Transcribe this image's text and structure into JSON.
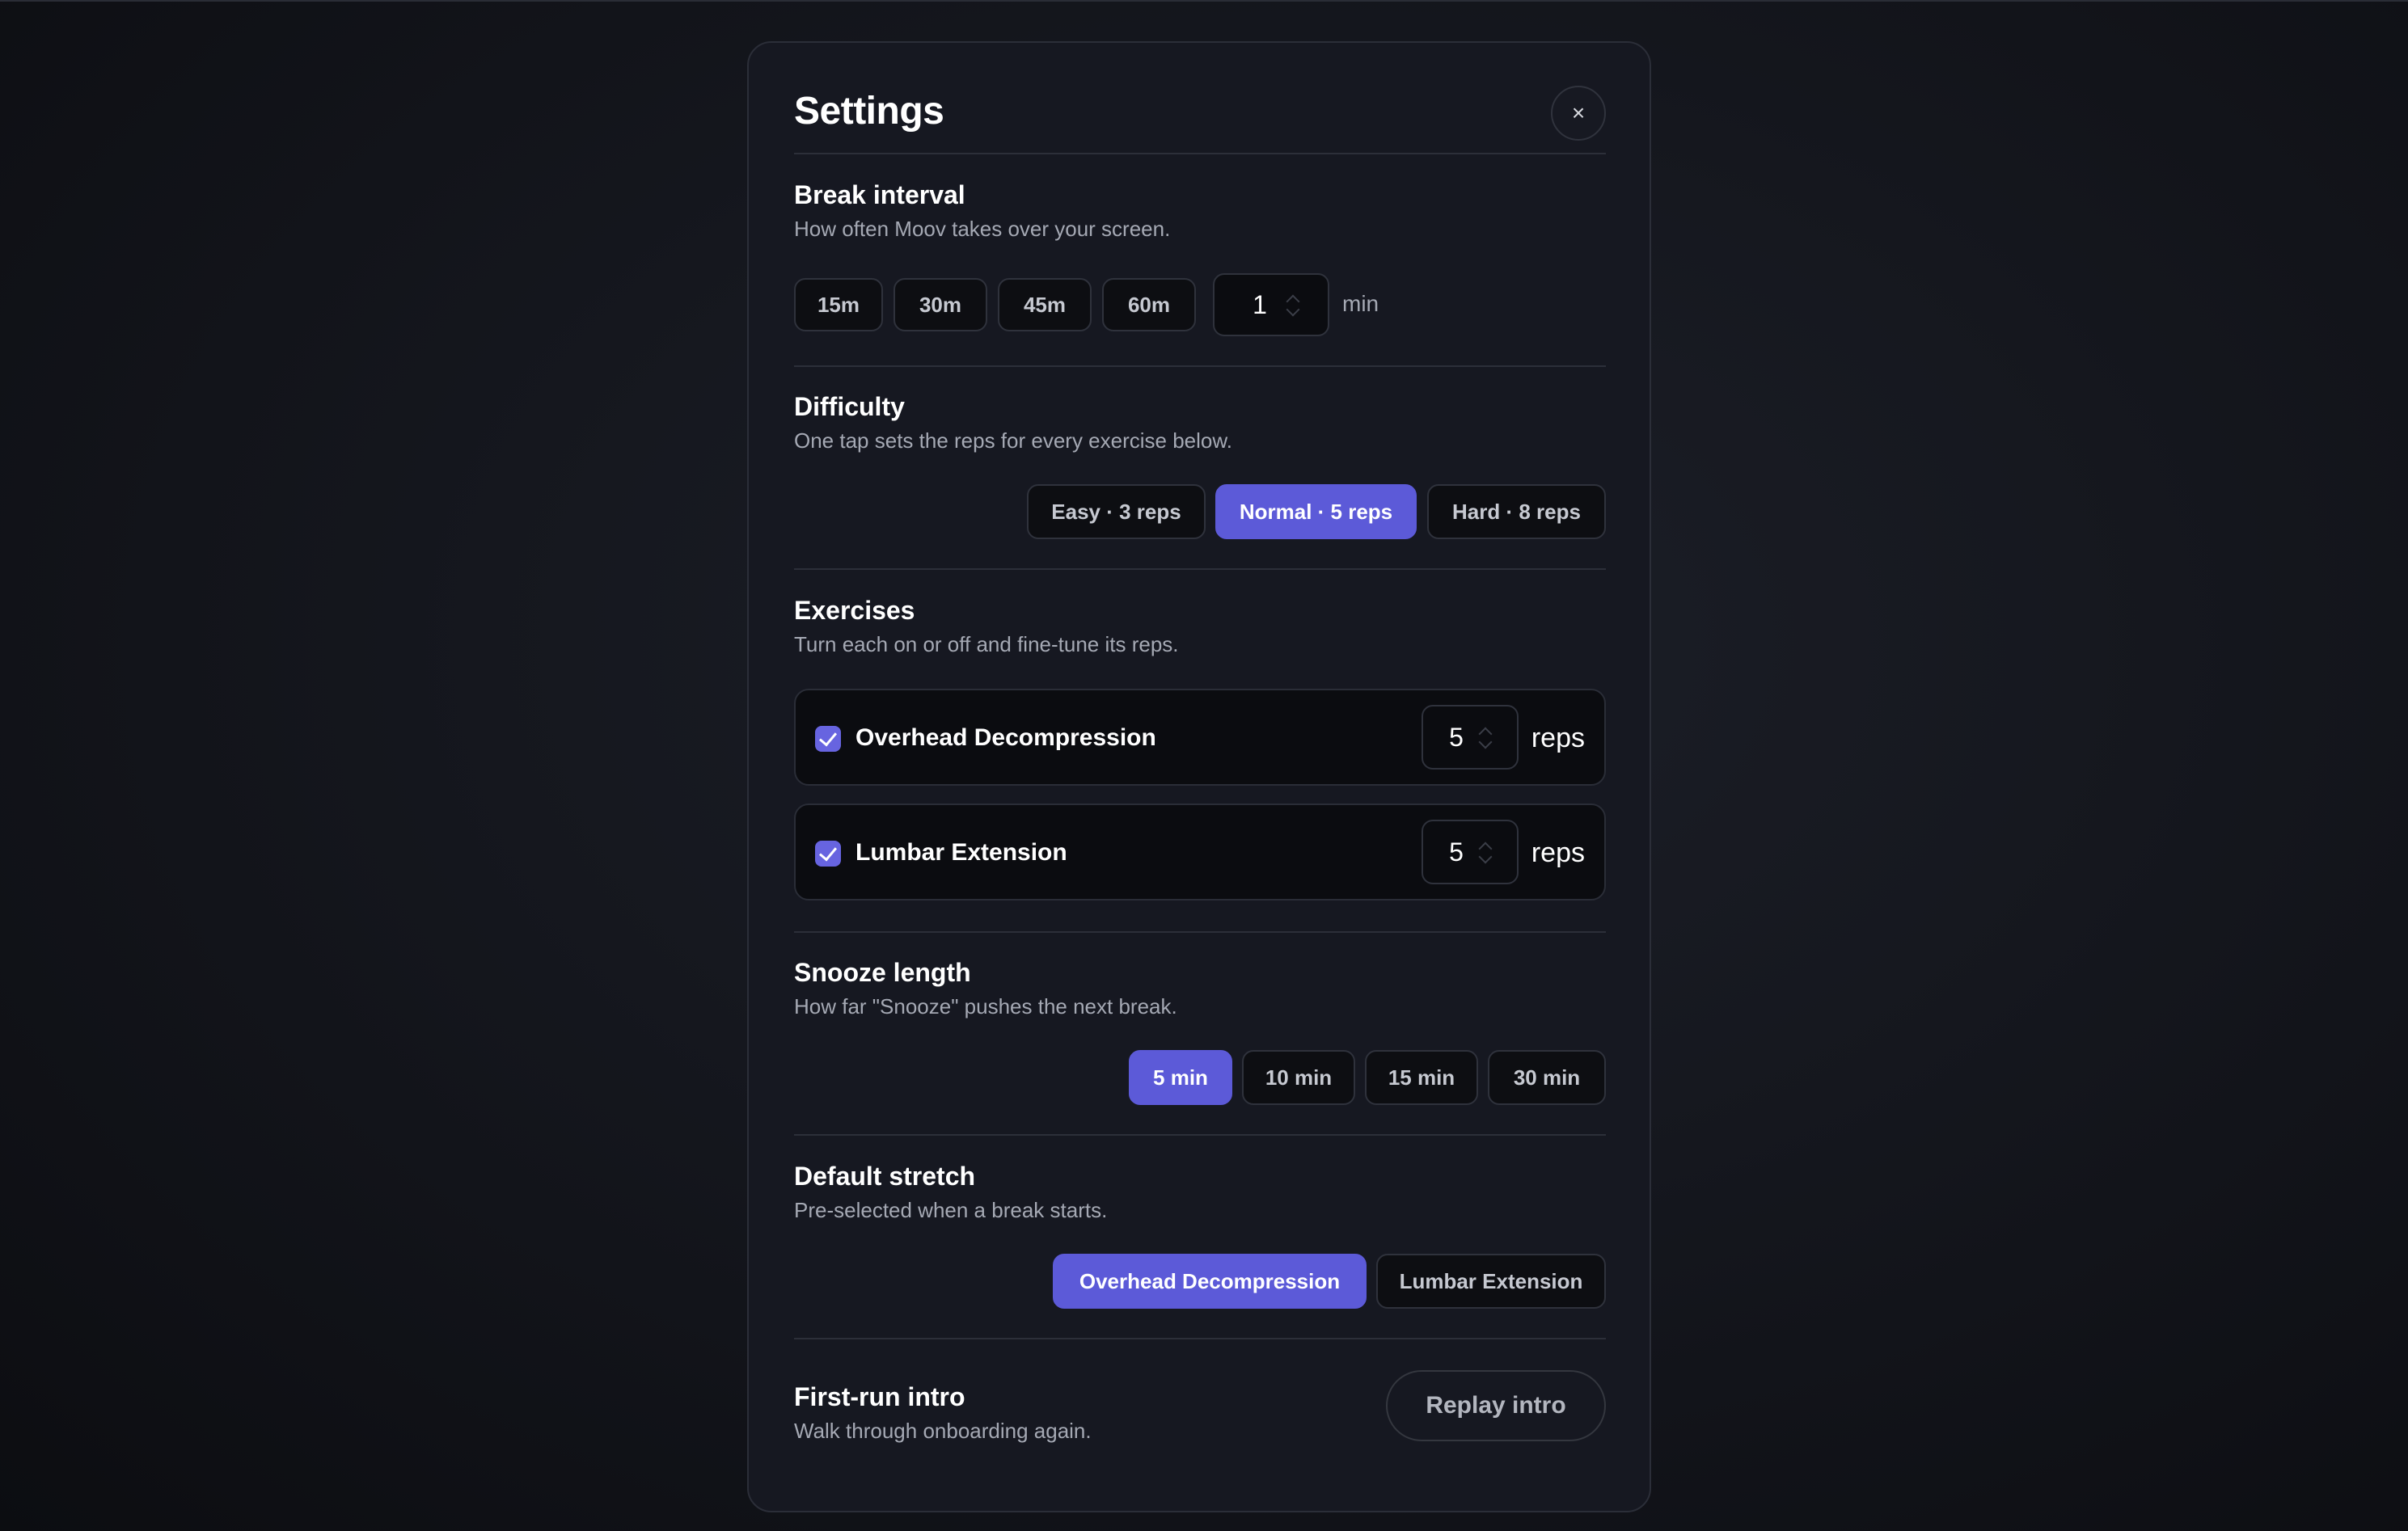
{
  "header": {
    "title": "Settings",
    "close_glyph": "×"
  },
  "break_interval": {
    "title": "Break interval",
    "description": "How often Moov takes over your screen.",
    "presets": [
      "15m",
      "30m",
      "45m",
      "60m"
    ],
    "custom_value": "1",
    "unit": "min"
  },
  "difficulty": {
    "title": "Difficulty",
    "description": "One tap sets the reps for every exercise below.",
    "options": [
      "Easy · 3 reps",
      "Normal · 5 reps",
      "Hard · 8 reps"
    ],
    "selected": "Normal · 5 reps"
  },
  "exercises": {
    "title": "Exercises",
    "description": "Turn each on or off and fine-tune its reps.",
    "items": [
      {
        "name": "Overhead Decompression",
        "enabled": true,
        "reps": "5",
        "unit": "reps"
      },
      {
        "name": "Lumbar Extension",
        "enabled": true,
        "reps": "5",
        "unit": "reps"
      }
    ]
  },
  "snooze": {
    "title": "Snooze length",
    "description": "How far \"Snooze\" pushes the next break.",
    "options": [
      "5 min",
      "10 min",
      "15 min",
      "30 min"
    ],
    "selected": "5 min"
  },
  "default_stretch": {
    "title": "Default stretch",
    "description": "Pre-selected when a break starts.",
    "options": [
      "Overhead Decompression",
      "Lumbar Extension"
    ],
    "selected": "Overhead Decompression"
  },
  "first_run": {
    "title": "First-run intro",
    "description": "Walk through onboarding again.",
    "button_label": "Replay intro"
  },
  "colors": {
    "accent": "#5c5ad8",
    "panel_bg": "#161821",
    "chip_bg": "#0d0e12",
    "text_muted": "#a5a9b4"
  }
}
